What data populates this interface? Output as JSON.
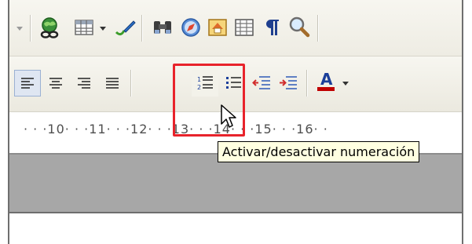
{
  "toolbar_top": {
    "icons": [
      "dropdown-arrow-icon",
      "hyperlink-globe-icon",
      "table-icon",
      "table-dropdown-arrow-icon",
      "drawing-pencil-icon",
      "binoculars-find-icon",
      "navigator-compass-icon",
      "gallery-icon",
      "data-sources-icon",
      "formatting-marks-icon",
      "zoom-magnifier-icon"
    ]
  },
  "toolbar_format": {
    "icons": [
      "align-left-icon",
      "align-center-icon",
      "align-right-icon",
      "justify-icon",
      "numbering-list-icon",
      "bullets-list-icon",
      "decrease-indent-icon",
      "increase-indent-icon",
      "font-color-icon",
      "font-color-dropdown-icon"
    ],
    "font_color_sample": "#c00000"
  },
  "ruler": {
    "labels": [
      "10",
      "11",
      "12",
      "13",
      "14",
      "15",
      "16"
    ],
    "text": "· · ·10· · ·11· · ·12· · ·13· · ·14· · ·15· · ·16· ·"
  },
  "tooltip": {
    "text": "Activar/desactivar numeración"
  },
  "colors": {
    "highlight": "#e8232b",
    "tooltip_bg": "#ffffe1",
    "gray_band": "#a7a7a7"
  }
}
